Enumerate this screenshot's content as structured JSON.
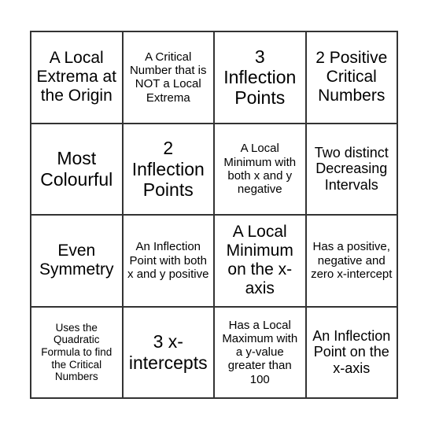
{
  "cells": [
    {
      "text": "A Local Extrema at the Origin",
      "size": "l"
    },
    {
      "text": "A Critical Number that is NOT a Local Extrema",
      "size": "s"
    },
    {
      "text": "3 Inflection Points",
      "size": "xl"
    },
    {
      "text": "2 Positive Critical Numbers",
      "size": "l"
    },
    {
      "text": "Most Colourful",
      "size": "xl"
    },
    {
      "text": "2 Inflection Points",
      "size": "xl"
    },
    {
      "text": "A Local Minimum with both x and y negative",
      "size": "s"
    },
    {
      "text": "Two distinct Decreasing Intervals",
      "size": "m"
    },
    {
      "text": "Even Symmetry",
      "size": "l"
    },
    {
      "text": "An Inflection Point with both x and y positive",
      "size": "s"
    },
    {
      "text": "A Local Minimum on the x-axis",
      "size": "l"
    },
    {
      "text": "Has a positive, negative and zero x-intercept",
      "size": "s"
    },
    {
      "text": "Uses the Quadratic Formula to find the Critical Numbers",
      "size": "xs"
    },
    {
      "text": "3 x-intercepts",
      "size": "xl"
    },
    {
      "text": "Has a Local Maximum with a y-value greater than 100",
      "size": "s"
    },
    {
      "text": "An Inflection Point on the x-axis",
      "size": "m"
    }
  ]
}
